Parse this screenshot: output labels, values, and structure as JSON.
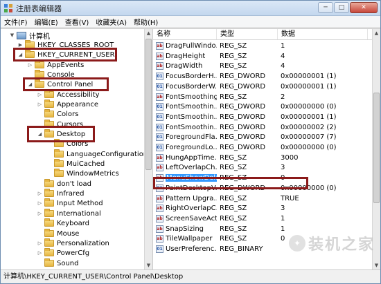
{
  "window": {
    "title": "注册表编辑器",
    "buttons": [
      "─",
      "□",
      "✕"
    ]
  },
  "menu": [
    "文件(F)",
    "编辑(E)",
    "查看(V)",
    "收藏夹(A)",
    "帮助(H)"
  ],
  "tree": [
    {
      "label": "计算机",
      "expander": "▼",
      "icon": "computer-icon"
    },
    {
      "label": "HKEY_CLASSES_ROOT",
      "expander": "▶",
      "icon": "folder-icon"
    },
    {
      "label": "HKEY_CURRENT_USER",
      "expander": "◢",
      "icon": "folder-icon"
    },
    {
      "label": "AppEvents",
      "expander": "▷",
      "icon": "folder-icon"
    },
    {
      "label": "Console",
      "expander": "",
      "icon": "folder-icon"
    },
    {
      "label": "Control Panel",
      "expander": "◢",
      "icon": "folder-icon"
    },
    {
      "label": "Accessibility",
      "expander": "▷",
      "icon": "folder-icon"
    },
    {
      "label": "Appearance",
      "expander": "▷",
      "icon": "folder-icon"
    },
    {
      "label": "Colors",
      "expander": "",
      "icon": "folder-icon"
    },
    {
      "label": "Cursors",
      "expander": "",
      "icon": "folder-icon"
    },
    {
      "label": "Desktop",
      "expander": "◢",
      "icon": "folder-icon"
    },
    {
      "label": "Colors",
      "expander": "",
      "icon": "folder-icon"
    },
    {
      "label": "LanguageConfiguration",
      "expander": "",
      "icon": "folder-icon"
    },
    {
      "label": "MuiCached",
      "expander": "",
      "icon": "folder-icon"
    },
    {
      "label": "WindowMetrics",
      "expander": "",
      "icon": "folder-icon"
    },
    {
      "label": "don't load",
      "expander": "",
      "icon": "folder-icon"
    },
    {
      "label": "Infrared",
      "expander": "▷",
      "icon": "folder-icon"
    },
    {
      "label": "Input Method",
      "expander": "▷",
      "icon": "folder-icon"
    },
    {
      "label": "International",
      "expander": "▷",
      "icon": "folder-icon"
    },
    {
      "label": "Keyboard",
      "expander": "",
      "icon": "folder-icon"
    },
    {
      "label": "Mouse",
      "expander": "",
      "icon": "folder-icon"
    },
    {
      "label": "Personalization",
      "expander": "▷",
      "icon": "folder-icon"
    },
    {
      "label": "PowerCfg",
      "expander": "▷",
      "icon": "folder-icon"
    },
    {
      "label": "Sound",
      "expander": "",
      "icon": "folder-icon"
    }
  ],
  "list": {
    "headers": [
      "名称",
      "类型",
      "数据"
    ],
    "rows": [
      {
        "name": "DragFullWindo...",
        "type": "REG_SZ",
        "data": "1",
        "icon": "ab"
      },
      {
        "name": "DragHeight",
        "type": "REG_SZ",
        "data": "4",
        "icon": "ab"
      },
      {
        "name": "DragWidth",
        "type": "REG_SZ",
        "data": "4",
        "icon": "ab"
      },
      {
        "name": "FocusBorderH...",
        "type": "REG_DWORD",
        "data": "0x00000001 (1)",
        "icon": "bin"
      },
      {
        "name": "FocusBorderW...",
        "type": "REG_DWORD",
        "data": "0x00000001 (1)",
        "icon": "bin"
      },
      {
        "name": "FontSmoothing",
        "type": "REG_SZ",
        "data": "2",
        "icon": "ab"
      },
      {
        "name": "FontSmoothin...",
        "type": "REG_DWORD",
        "data": "0x00000000 (0)",
        "icon": "bin"
      },
      {
        "name": "FontSmoothin...",
        "type": "REG_DWORD",
        "data": "0x00000001 (1)",
        "icon": "bin"
      },
      {
        "name": "FontSmoothin...",
        "type": "REG_DWORD",
        "data": "0x00000002 (2)",
        "icon": "bin"
      },
      {
        "name": "ForegroundFla...",
        "type": "REG_DWORD",
        "data": "0x00000007 (7)",
        "icon": "bin"
      },
      {
        "name": "ForegroundLo...",
        "type": "REG_DWORD",
        "data": "0x00000000 (0)",
        "icon": "bin"
      },
      {
        "name": "HungAppTime...",
        "type": "REG_SZ",
        "data": "3000",
        "icon": "ab"
      },
      {
        "name": "LeftOverlapCh...",
        "type": "REG_SZ",
        "data": "3",
        "icon": "ab"
      },
      {
        "name": "MenuShowDelay",
        "type": "REG_SZ",
        "data": "0",
        "icon": "ab"
      },
      {
        "name": "PaintDesktopV...",
        "type": "REG_DWORD",
        "data": "0x00000000 (0)",
        "icon": "bin"
      },
      {
        "name": "Pattern Upgra...",
        "type": "REG_SZ",
        "data": "TRUE",
        "icon": "ab"
      },
      {
        "name": "RightOverlapC...",
        "type": "REG_SZ",
        "data": "3",
        "icon": "ab"
      },
      {
        "name": "ScreenSaveActi...",
        "type": "REG_SZ",
        "data": "1",
        "icon": "ab"
      },
      {
        "name": "SnapSizing",
        "type": "REG_SZ",
        "data": "1",
        "icon": "ab"
      },
      {
        "name": "TileWallpaper",
        "type": "REG_SZ",
        "data": "0",
        "icon": "ab"
      },
      {
        "name": "UserPreferenc...",
        "type": "REG_BINARY",
        "data": "",
        "icon": "bin"
      }
    ]
  },
  "status": "计算机\\HKEY_CURRENT_USER\\Control Panel\\Desktop",
  "watermark": "装机之家",
  "colors": {
    "highlight_box": "#8b1a1a",
    "selection": "#3399ff"
  }
}
